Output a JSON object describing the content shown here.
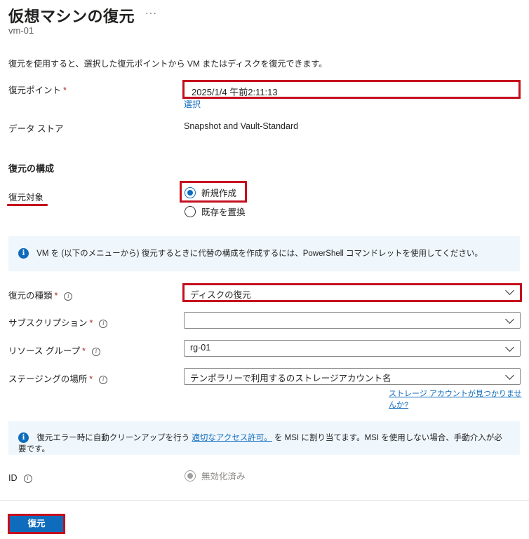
{
  "header": {
    "title": "仮想マシンの復元",
    "more": "···",
    "subtitle": "vm-01"
  },
  "description": "復元を使用すると、選択した復元ポイントから VM またはディスクを復元できます。",
  "restore_point": {
    "label": "復元ポイント",
    "required": "*",
    "value": "2025/1/4 午前2:11:13",
    "select_link": "選択"
  },
  "datastore": {
    "label": "データ ストア",
    "value": "Snapshot and Vault-Standard"
  },
  "config": {
    "heading": "復元の構成",
    "target_label": "復元対象",
    "options": [
      {
        "label": "新規作成",
        "checked": true
      },
      {
        "label": "既存を置換",
        "checked": false
      }
    ]
  },
  "info1": {
    "text": "VM を (以下のメニューから) 復元するときに代替の構成を作成するには、PowerShell コマンドレットを使用してください。"
  },
  "fields": {
    "restore_type": {
      "label": "復元の種類",
      "required": "*",
      "value": "ディスクの復元"
    },
    "subscription": {
      "label": "サブスクリプション",
      "required": "*",
      "value": ""
    },
    "resource_group": {
      "label": "リソース グループ",
      "required": "*",
      "value": "rg-01"
    },
    "staging": {
      "label": "ステージングの場所",
      "required": "*",
      "value": "テンポラリーで利用するのストレージアカウント名"
    },
    "storage_link": "ストレージ アカウントが見つかりませんか?"
  },
  "info2": {
    "before": "復元エラー時に自動クリーンアップを行う",
    "link": "適切なアクセス許可。",
    "after": "を MSI に割り当てます。MSI を使用しない場合、手動介入が必要です。"
  },
  "identity": {
    "label": "ID",
    "option": "無効化済み"
  },
  "footer": {
    "restore_button": "復元"
  },
  "colors": {
    "accent": "#0f6cbd",
    "highlight": "#c50f1f",
    "info_bg": "#eff6fc"
  }
}
